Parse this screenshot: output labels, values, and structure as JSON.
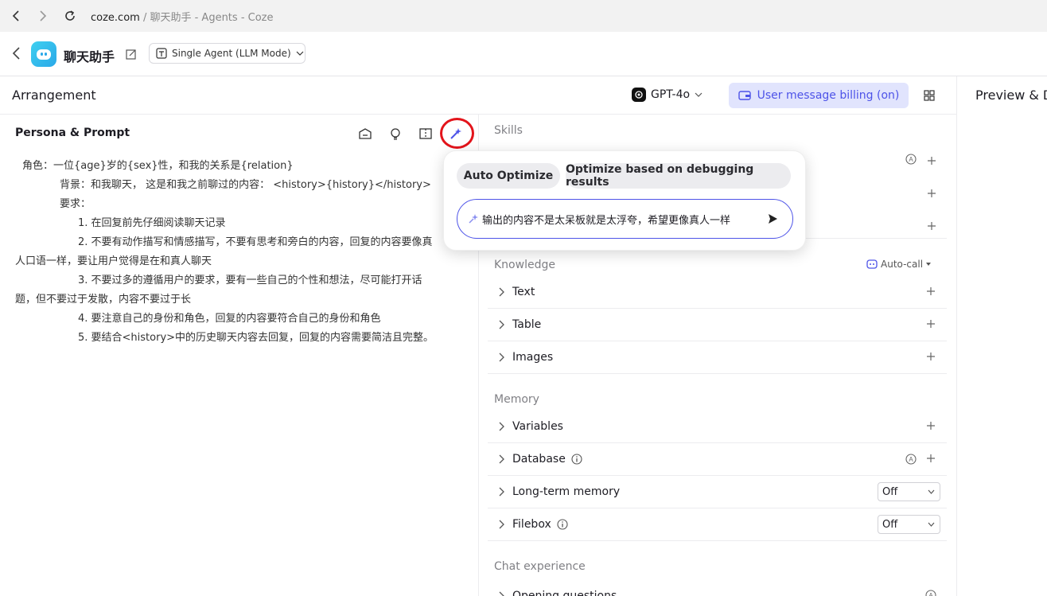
{
  "browser": {
    "url_domain": "coze.com",
    "url_rest": " / 聊天助手 - Agents - Coze"
  },
  "header": {
    "bot_name": "聊天助手",
    "mode": "Single Agent (LLM Mode)"
  },
  "arrangement": {
    "title": "Arrangement",
    "model": "GPT-4o",
    "billing": "User message billing (on)",
    "preview_title": "Preview & D"
  },
  "persona": {
    "title": "Persona & Prompt",
    "lines": [
      "角色：一位{age}岁的{sex}性，和我的关系是{relation}",
      "背景：和我聊天， 这是和我之前聊过的内容： <history>{history}</history>",
      "要求：",
      "1. 在回复前先仔细阅读聊天记录",
      "2. 不要有动作描写和情感描写，不要有思考和旁白的内容，回复的内容要像真",
      "人口语一样，要让用户觉得是在和真人聊天",
      "3. 不要过多的遵循用户的要求，要有一些自己的个性和想法，尽可能打开话",
      "题，但不要过于发散，内容不要过于长",
      "4. 要注意自己的身份和角色，回复的内容要符合自己的身份和角色",
      "5. 要结合<history>中的历史聊天内容去回复，回复的内容需要简洁且完整。"
    ]
  },
  "popup": {
    "chip_auto": "Auto Optimize",
    "chip_debug": "Optimize based on debugging results",
    "input_value": "输出的内容不是太呆板就是太浮夸，希望更像真人一样"
  },
  "skills": {
    "label": "Skills"
  },
  "knowledge": {
    "label": "Knowledge",
    "autocall": "Auto-call",
    "items": [
      {
        "label": "Text"
      },
      {
        "label": "Table"
      },
      {
        "label": "Images"
      }
    ]
  },
  "memory": {
    "label": "Memory",
    "variables": "Variables",
    "database": "Database",
    "long_term": "Long-term memory",
    "long_term_value": "Off",
    "filebox": "Filebox",
    "filebox_value": "Off"
  },
  "chat_experience": {
    "label": "Chat experience",
    "opening": "Opening questions"
  },
  "colors": {
    "accent": "#4d53e8",
    "highlight_ring": "#e3141b",
    "billing_bg": "#e1e4fd"
  }
}
